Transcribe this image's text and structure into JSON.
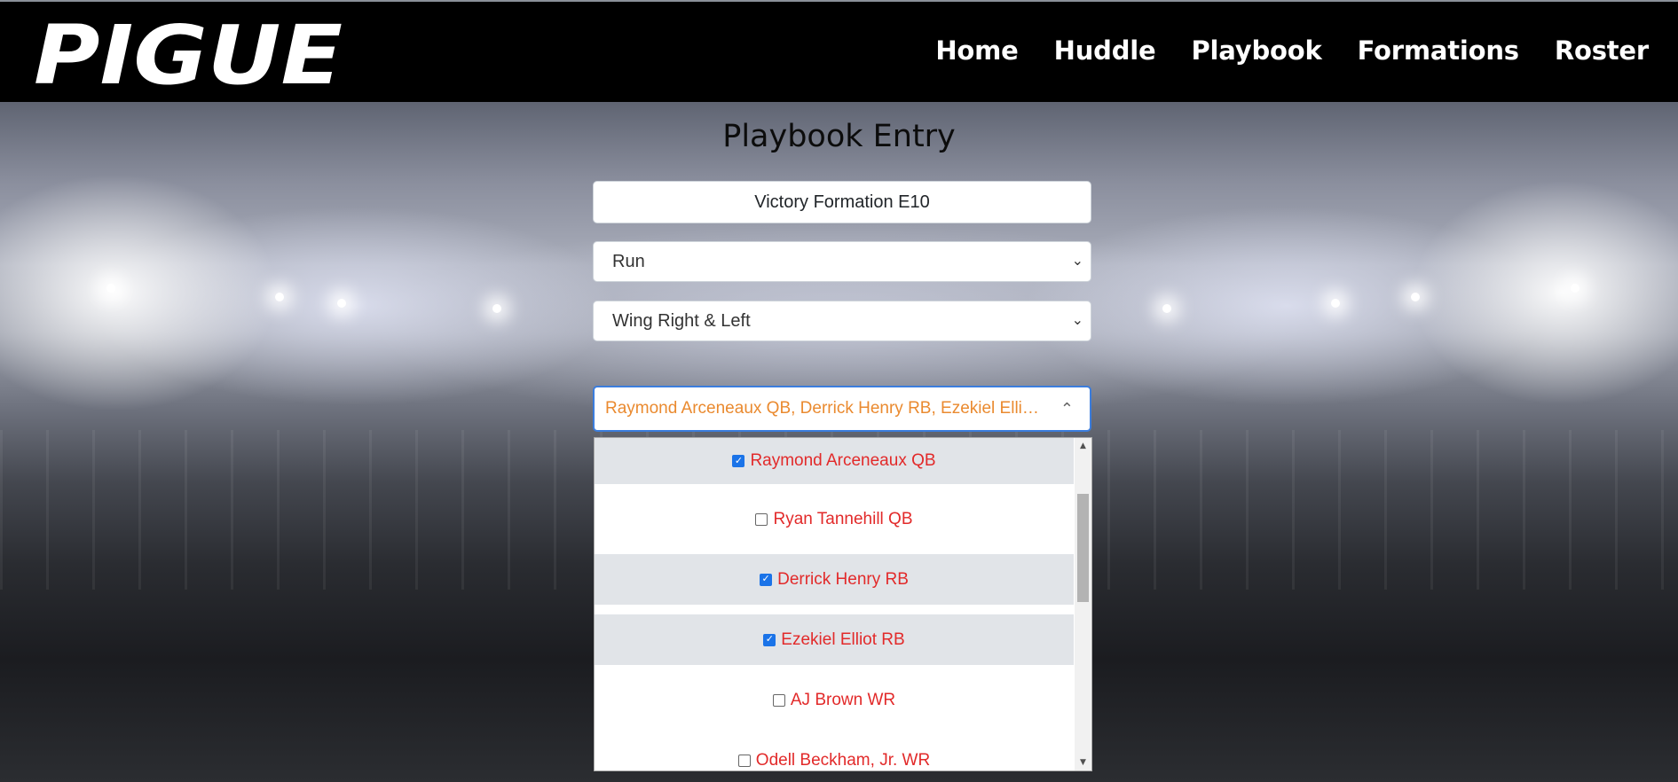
{
  "app": {
    "logo_text": "PIGUE"
  },
  "nav": {
    "items": [
      "Home",
      "Huddle",
      "Playbook",
      "Formations",
      "Roster"
    ]
  },
  "page": {
    "title": "Playbook Entry"
  },
  "form": {
    "play_name": "Victory Formation E10",
    "play_type": "Run",
    "formation": "Wing Right & Left",
    "players_summary": "Raymond Arceneaux QB, Derrick Henry RB, Ezekiel Ellio..."
  },
  "players": [
    {
      "label": "Raymond Arceneaux QB",
      "checked": true
    },
    {
      "label": "Ryan Tannehill QB",
      "checked": false
    },
    {
      "label": "Derrick Henry RB",
      "checked": true
    },
    {
      "label": "Ezekiel Elliot RB",
      "checked": true
    },
    {
      "label": "AJ Brown WR",
      "checked": false
    },
    {
      "label": "Odell Beckham, Jr. WR",
      "checked": false
    }
  ],
  "colors": {
    "navbar": "#000000",
    "option_text": "#e22a2a",
    "summary_text": "#ea8a2f",
    "focus_border": "#3b7ddd"
  }
}
